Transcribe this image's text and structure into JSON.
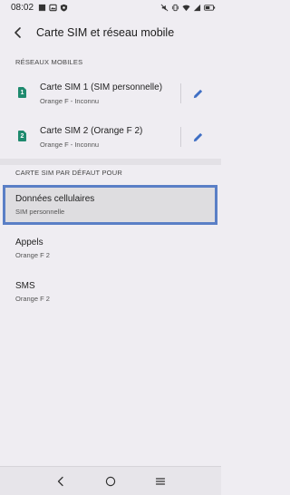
{
  "status_bar": {
    "time": "08:02",
    "left_icons": [
      "notification-icon",
      "image-icon",
      "shield-icon"
    ],
    "right_icons": [
      "mute-icon",
      "vibrate-icon",
      "wifi-icon",
      "signal-icon",
      "battery-icon"
    ]
  },
  "app_bar": {
    "title": "Carte SIM et réseau mobile",
    "back_icon": "back-arrow-icon"
  },
  "sections": {
    "networks_header": "RÉSEAUX MOBILES",
    "default_header": "CARTE SIM PAR DÉFAUT POUR"
  },
  "sims": [
    {
      "badge": "1",
      "title": "Carte SIM 1 (SIM personnelle)",
      "subtitle": "Orange F - Inconnu"
    },
    {
      "badge": "2",
      "title": "Carte SIM 2 (Orange F 2)",
      "subtitle": "Orange F - Inconnu"
    }
  ],
  "defaults": [
    {
      "title": "Données cellulaires",
      "subtitle": "SIM personnelle"
    },
    {
      "title": "Appels",
      "subtitle": "Orange F 2"
    },
    {
      "title": "SMS",
      "subtitle": "Orange F 2"
    }
  ],
  "colors": {
    "accent": "#3f6fc4",
    "sim_badge": "#1e8a6e",
    "selection_outline": "#5a7fc6"
  },
  "nav_icons": [
    "back-icon",
    "home-icon",
    "recents-icon"
  ]
}
